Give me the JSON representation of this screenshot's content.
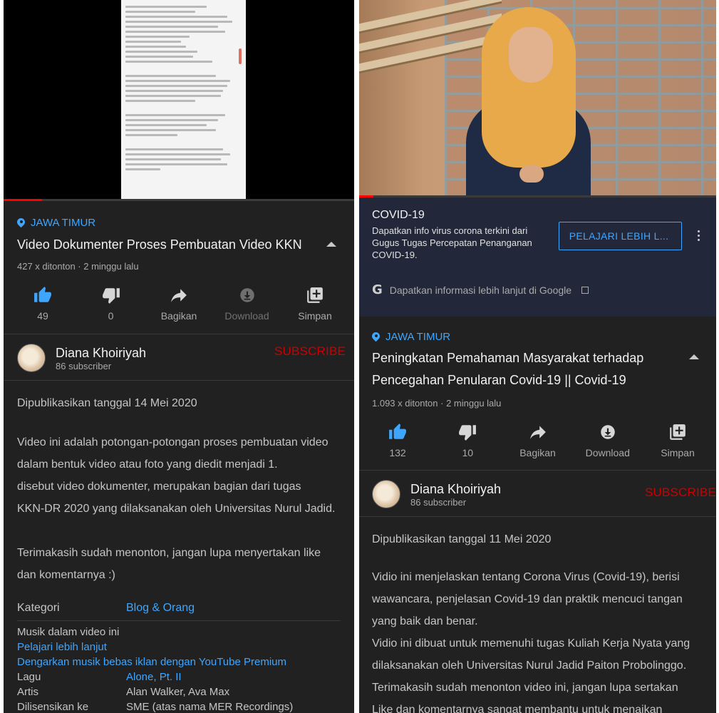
{
  "left": {
    "video_progress_pct": 11,
    "location": "JAWA TIMUR",
    "title": "Video Dokumenter Proses Pembuatan Video KKN",
    "meta": "427 x ditonton · 2 minggu lalu",
    "actions": {
      "like": "49",
      "dislike": "0",
      "share": "Bagikan",
      "download": "Download",
      "save": "Simpan"
    },
    "channel": {
      "name": "Diana Khoiriyah",
      "subs": "86 subscriber",
      "subscribe": "SUBSCRIBE"
    },
    "published": "Dipublikasikan tanggal 14 Mei 2020",
    "description": [
      "Video ini adalah potongan-potongan proses pembuatan video",
      "dalam bentuk video atau foto yang diedit menjadi 1.",
      "disebut video dokumenter, merupakan bagian dari tugas",
      "KKN-DR 2020 yang dilaksanakan oleh Universitas Nurul Jadid."
    ],
    "thanks": [
      "Terimakasih sudah menonton, jangan lupa menyertakan like",
      "dan komentarnya :)"
    ],
    "category_label": "Kategori",
    "category_value": "Blog & Orang",
    "music_heading": "Musik dalam video ini",
    "learn_more": "Pelajari lebih lanjut",
    "premium_link": "Dengarkan musik bebas iklan dengan YouTube Premium",
    "song_label": "Lagu",
    "song_value": "Alone, Pt. II",
    "artist_label": "Artis",
    "artist_value": "Alan Walker, Ava Max",
    "license_label": "Dilisensikan ke",
    "license_value": "SME (atas nama MER Recordings)"
  },
  "right": {
    "video_progress_pct": 4,
    "info": {
      "title": "COVID-19",
      "text": "Dapatkan info virus corona terkini dari Gugus Tugas Percepatan Penanganan COVID-19.",
      "button": "PELAJARI LEBIH L...",
      "google": "Dapatkan informasi lebih lanjut di Google"
    },
    "location": "JAWA TIMUR",
    "title": "Peningkatan Pemahaman Masyarakat terhadap Pencegahan Penularan Covid-19 || Covid-19",
    "meta": "1.093 x ditonton · 2 minggu lalu",
    "actions": {
      "like": "132",
      "dislike": "10",
      "share": "Bagikan",
      "download": "Download",
      "save": "Simpan"
    },
    "channel": {
      "name": "Diana Khoiriyah",
      "subs": "86 subscriber",
      "subscribe": "SUBSCRIBE"
    },
    "published": "Dipublikasikan tanggal 11 Mei 2020",
    "description": [
      "Vidio ini menjelaskan tentang Corona Virus (Covid-19), berisi",
      "wawancara, penjelasan Covid-19 dan praktik mencuci tangan",
      "yang baik dan benar.",
      "Vidio ini dibuat untuk memenuhi tugas Kuliah Kerja Nyata yang",
      "dilaksanakan oleh Universitas Nurul Jadid Paiton Probolinggo.",
      "Terimakasih sudah menonton video ini, jangan lupa sertakan",
      "Like dan komentarnya sangat membantu untuk menaikan"
    ]
  },
  "colors": {
    "background": "#212121",
    "link": "#3ea6ff",
    "subscribe": "#cc0000",
    "progress": "#ff0000",
    "info_card": "#22283a"
  }
}
